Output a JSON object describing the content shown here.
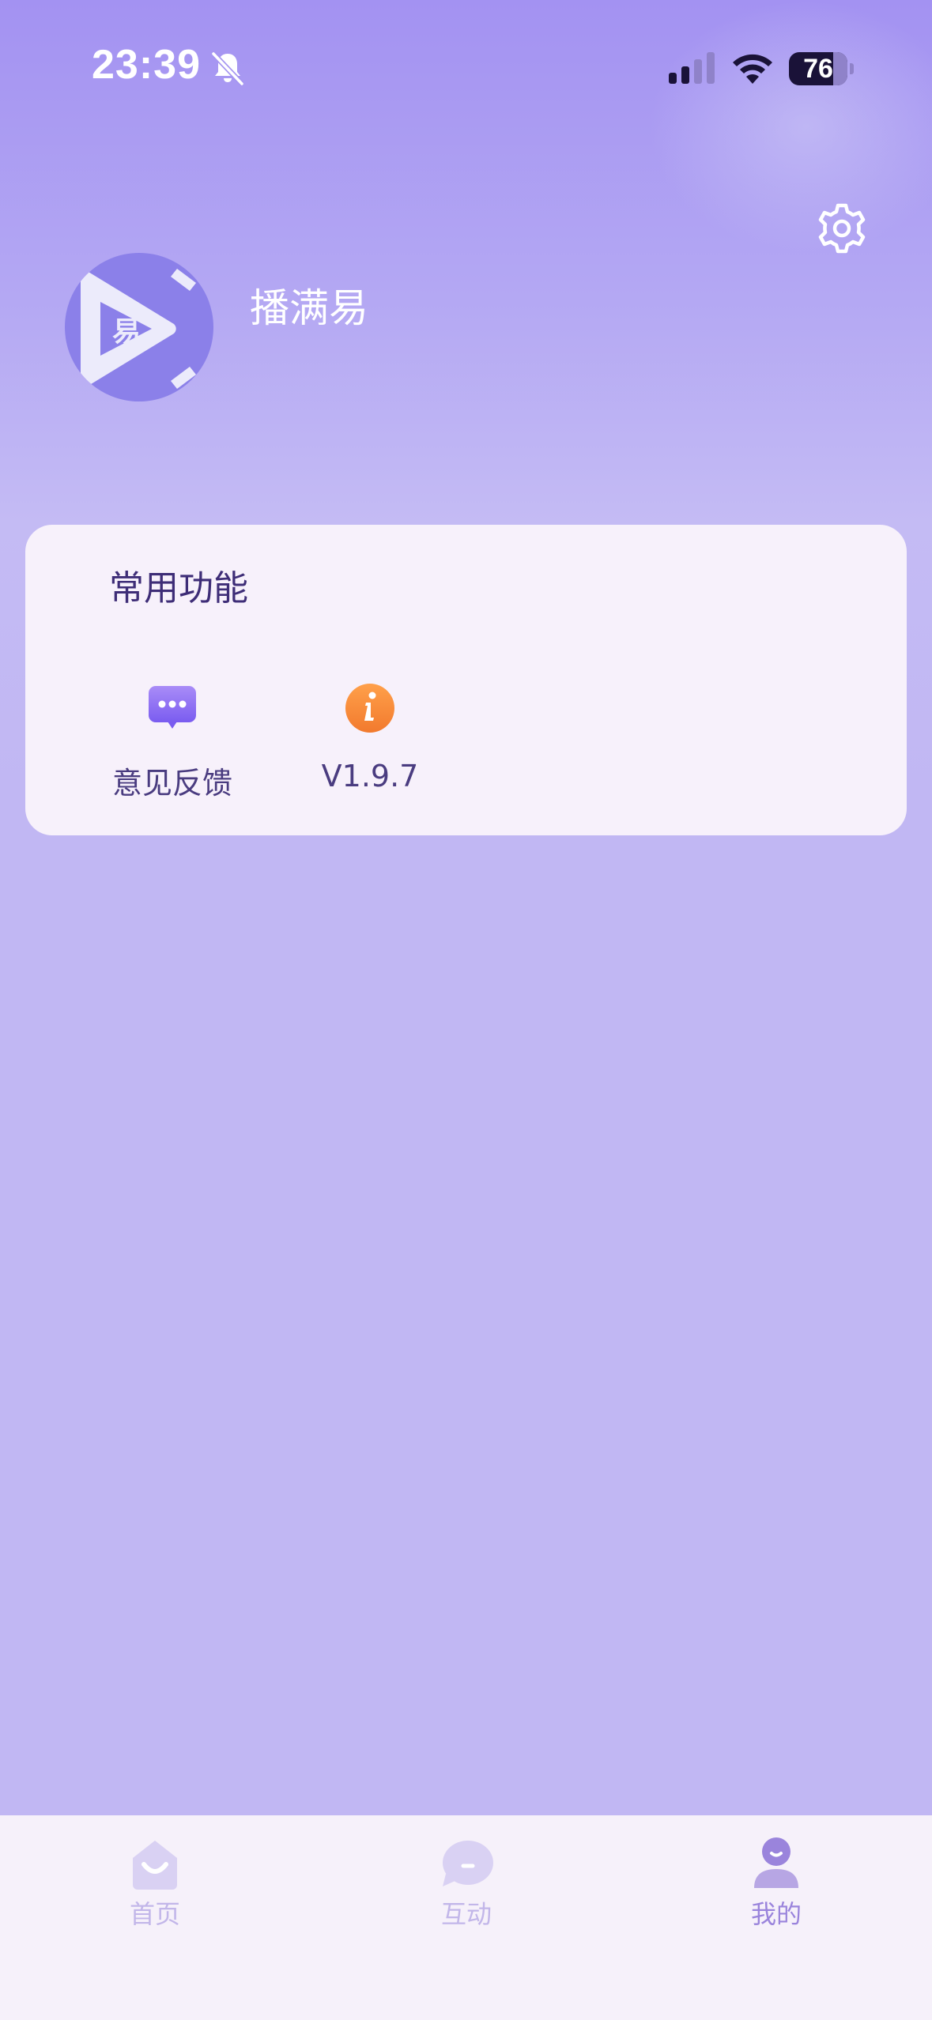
{
  "status_bar": {
    "time": "23:39",
    "battery": "76",
    "icons": [
      "bell-slash-icon",
      "cellular-signal-icon",
      "wifi-icon",
      "battery-icon"
    ]
  },
  "header": {
    "settings_icon": "gear-icon",
    "avatar_glyph": "易",
    "app_name": "播满易"
  },
  "common_functions": {
    "title": "常用功能",
    "items": [
      {
        "icon": "chat-bubble-icon",
        "label": "意见反馈"
      },
      {
        "icon": "info-icon",
        "label": "V1.9.7"
      }
    ]
  },
  "tab_bar": {
    "items": [
      {
        "icon": "home-icon",
        "label": "首页",
        "active": false
      },
      {
        "icon": "chat-icon",
        "label": "互动",
        "active": false
      },
      {
        "icon": "profile-icon",
        "label": "我的",
        "active": true
      }
    ]
  },
  "colors": {
    "accent": "#9a84dc",
    "inactive_tab": "#c2b6e9",
    "card_bg": "#f7f1fb",
    "title_text": "#3e2d77",
    "info_orange": "#f58a3c",
    "feedback_purple": "#8a6cf0"
  }
}
